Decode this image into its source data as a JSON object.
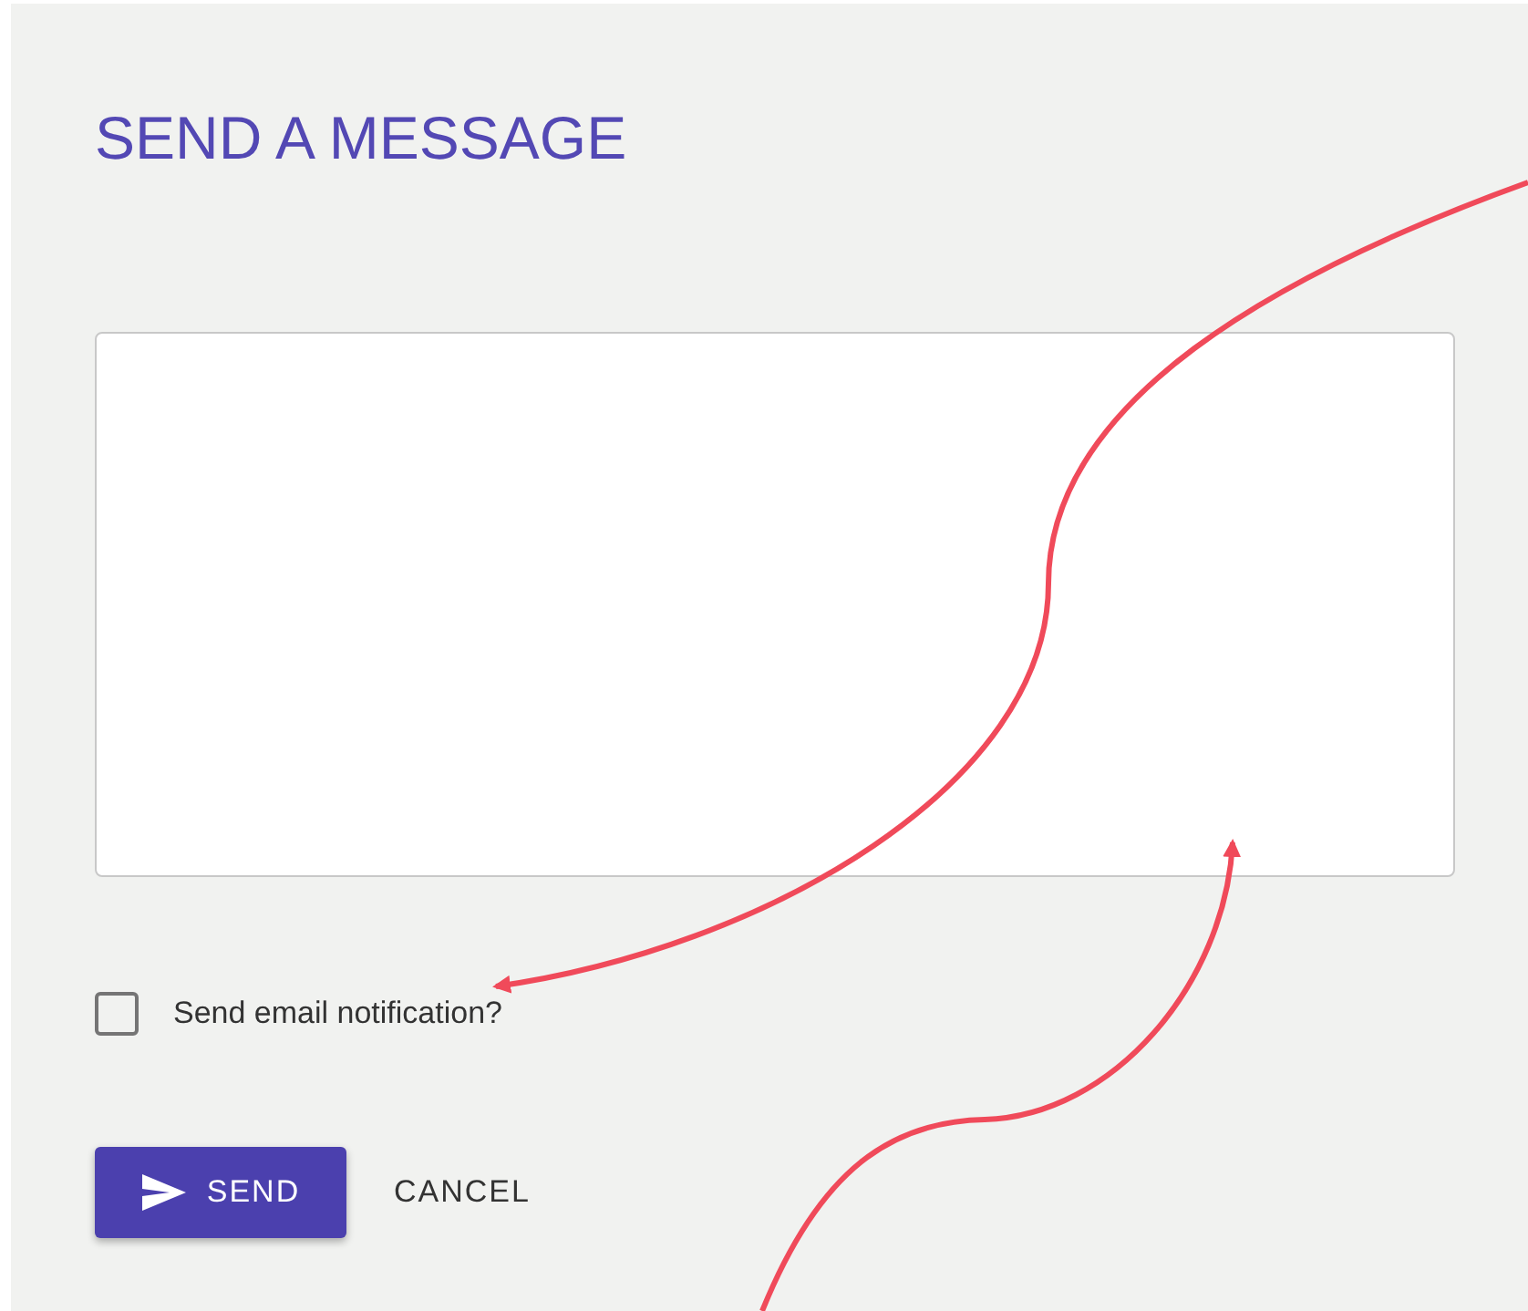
{
  "dialog": {
    "title": "SEND A MESSAGE"
  },
  "notification": {
    "label": "Send email notification?",
    "checked": false
  },
  "buttons": [
    {
      "label": "SEND",
      "kind": "primary"
    },
    {
      "label": "CANCEL",
      "kind": "text"
    }
  ]
}
